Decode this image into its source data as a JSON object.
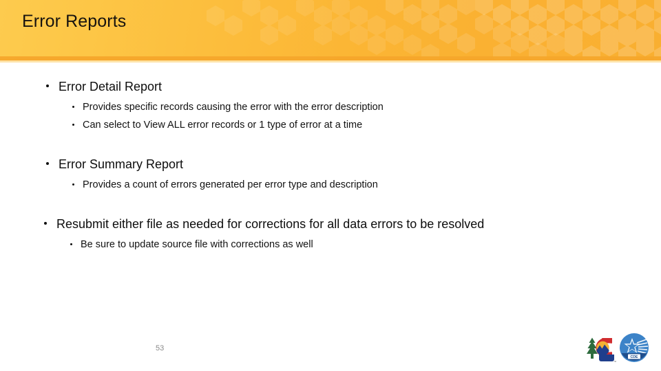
{
  "header": {
    "title": "Error Reports",
    "accent_color": "#FBB534",
    "accent_color_light": "#FDCB4E",
    "underline_color": "#F6A72B",
    "pattern": "honeycomb-hexagons"
  },
  "content": {
    "groups": [
      {
        "heading": "Error Detail Report",
        "sub_bullets": [
          "Provides specific records causing the error with the error description",
          "Can select to View ALL error records or 1 type of error at a time"
        ]
      },
      {
        "heading": "Error Summary Report",
        "sub_bullets": [
          "Provides a count of errors generated per error type and description"
        ]
      },
      {
        "heading": "Resubmit either file as needed for corrections for all data errors to be resolved",
        "sub_bullets": [
          "Be sure to update source file with corrections as well"
        ]
      }
    ]
  },
  "footer": {
    "page_number": "53",
    "page_number_color": "#8A8A8A",
    "logos": [
      {
        "name": "colorado-state-logo",
        "colors": {
          "tree": "#2E6B3E",
          "c_letter": "#D02C2F",
          "sun": "#F2B134",
          "mountain": "#1F3E8C"
        }
      },
      {
        "name": "cde-logo",
        "label": "CDE",
        "colors": {
          "circle": "#3C83C8",
          "band": "#1F4E8C",
          "star": "#FFFFFF"
        }
      }
    ]
  }
}
